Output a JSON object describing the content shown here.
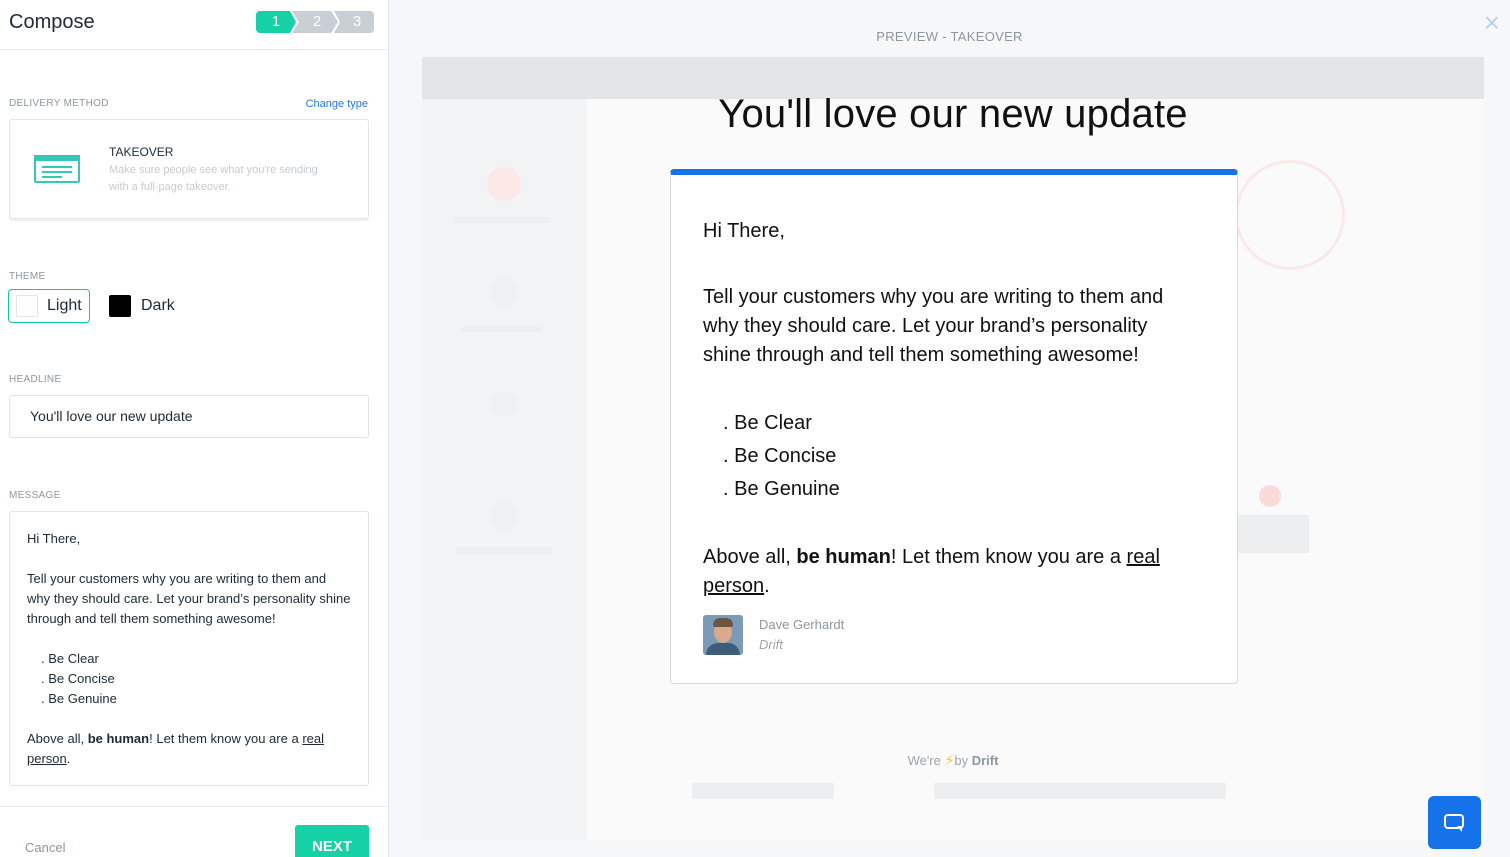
{
  "left": {
    "title": "Compose",
    "steps": [
      "1",
      "2",
      "3"
    ],
    "delivery_method_label": "DELIVERY METHOD",
    "change_type_label": "Change type",
    "delivery": {
      "name": "TAKEOVER",
      "description": "Make sure people see what you're sending with a full-page takeover."
    },
    "theme_label": "THEME",
    "theme_options": {
      "light": "Light",
      "dark": "Dark"
    },
    "theme_selected": "Light",
    "headline_label": "HEADLINE",
    "headline_value": "You'll love our new update",
    "message_label": "MESSAGE",
    "message": {
      "greeting": "Hi There,",
      "body": "Tell your customers why you are writing to them and why they should care. Let your brand’s personality shine through and tell them something awesome!",
      "bullets": [
        ". Be Clear",
        ". Be Concise",
        ". Be Genuine"
      ],
      "closing_prefix": "Above all, ",
      "closing_bold": "be human",
      "closing_mid": "! Let them know you are a ",
      "closing_link": "real person",
      "closing_end": "."
    },
    "cancel_label": "Cancel",
    "next_label": "NEXT"
  },
  "preview": {
    "label": "PREVIEW - TAKEOVER",
    "close_symbol": "×",
    "headline": "You'll love our new update",
    "accent_color": "#1572e8",
    "message": {
      "greeting": "Hi There,",
      "body": "Tell your customers why you are writing to them and why they should care. Let your brand’s personality shine through and tell them something awesome!",
      "bullets": [
        ". Be Clear",
        ". Be Concise",
        ". Be Genuine"
      ],
      "closing_prefix": "Above all, ",
      "closing_bold": "be human",
      "closing_mid": "! Let them know you are a ",
      "closing_link": "real person",
      "closing_end": "."
    },
    "author_name": "Dave Gerhardt",
    "author_org": "Drift",
    "branding_prefix": "We're",
    "branding_bolt": "⚡",
    "branding_by": "by",
    "branding_brand": "Drift"
  },
  "colors": {
    "primary_green": "#16d0a6",
    "link_blue": "#2478d9"
  },
  "icons": [
    "takeover-icon",
    "close-icon",
    "chat-icon",
    "bolt-icon",
    "avatar"
  ]
}
